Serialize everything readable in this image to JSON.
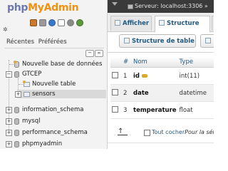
{
  "logo": {
    "part1": "php",
    "part2": "MyAdmin"
  },
  "nav_icons": [
    "home-icon",
    "exit-icon",
    "help-icon",
    "docs-icon",
    "settings-icon",
    "reload-icon"
  ],
  "nav_tabs": {
    "recent": "Récentes",
    "favorites": "Préférées"
  },
  "tree": {
    "new_db": "Nouvelle base de données",
    "db_gtcep": "GTCEP",
    "new_table": "Nouvelle table",
    "table_sensors": "sensors",
    "db_information_schema": "information_schema",
    "db_mysql": "mysql",
    "db_performance_schema": "performance_schema",
    "db_phpmyadmin": "phpmyadmin"
  },
  "serverbar": {
    "text": "Serveur: localhost:3306 »"
  },
  "tabs": {
    "afficher": "Afficher",
    "structure": "Structure"
  },
  "subnav": {
    "struct_table": "Structure de table"
  },
  "columns_table": {
    "headers": {
      "num": "#",
      "name": "Nom",
      "type": "Type"
    },
    "rows": [
      {
        "num": "1",
        "name": "id",
        "type": "int(11)"
      },
      {
        "num": "2",
        "name": "date",
        "type": "datetime"
      },
      {
        "num": "3",
        "name": "temperature",
        "type": "float"
      }
    ]
  },
  "footer": {
    "check_all": "Tout cocher",
    "with_selected": "Pour la sél"
  },
  "colors": {
    "link": "#235a81",
    "logo_php": "#6c78af",
    "logo_admin": "#f29111",
    "serverbar": "#3a3a3a"
  }
}
